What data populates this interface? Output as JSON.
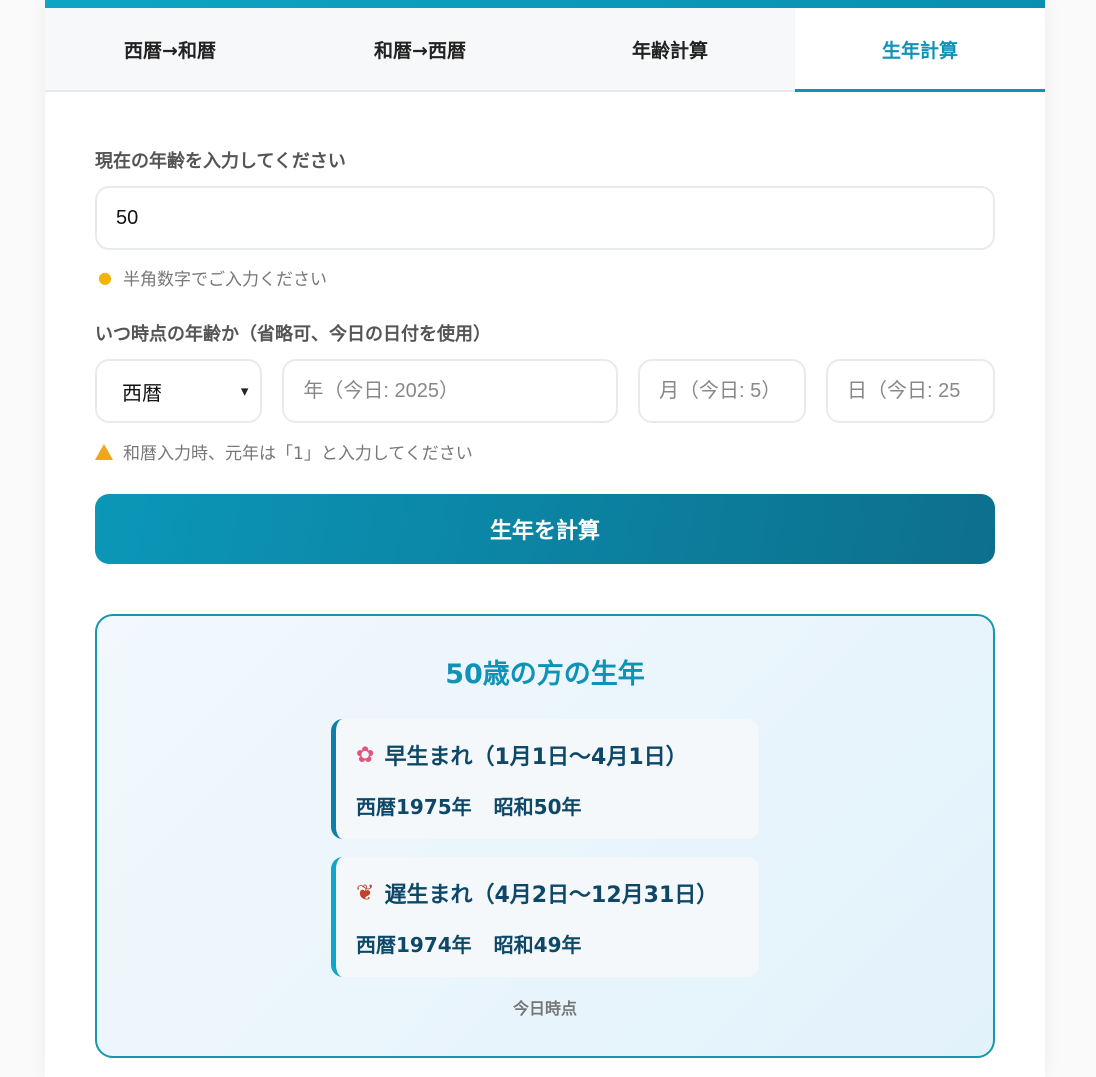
{
  "tabs": [
    {
      "label": "西暦→和暦"
    },
    {
      "label": "和暦→西暦"
    },
    {
      "label": "年齢計算"
    },
    {
      "label": "生年計算"
    }
  ],
  "form": {
    "age_label": "現在の年齢を入力してください",
    "age_value": "50",
    "age_hint": "半角数字でご入力ください",
    "date_label": "いつ時点の年齢か（省略可、今日の日付を使用）",
    "era_selected": "西暦",
    "year_placeholder": "年（今日: 2025）",
    "month_placeholder": "月（今日: 5）",
    "day_placeholder": "日（今日: 25",
    "warning": "和暦入力時、元年は「1」と入力してください",
    "submit_label": "生年を計算"
  },
  "result": {
    "title": "50歳の方の生年",
    "early": {
      "heading": "早生まれ（1月1日〜4月1日）",
      "western": "西暦1975年",
      "japanese": "昭和50年"
    },
    "late": {
      "heading": "遅生まれ（4月2日〜12月31日）",
      "western": "西暦1974年",
      "japanese": "昭和49年"
    },
    "footnote": "今日時点"
  },
  "colors": {
    "accent": "#0e93b6",
    "button_start": "#0b97b8",
    "button_end": "#0d6f8d",
    "result_border": "#1797ad",
    "result_text": "#0e4868"
  }
}
